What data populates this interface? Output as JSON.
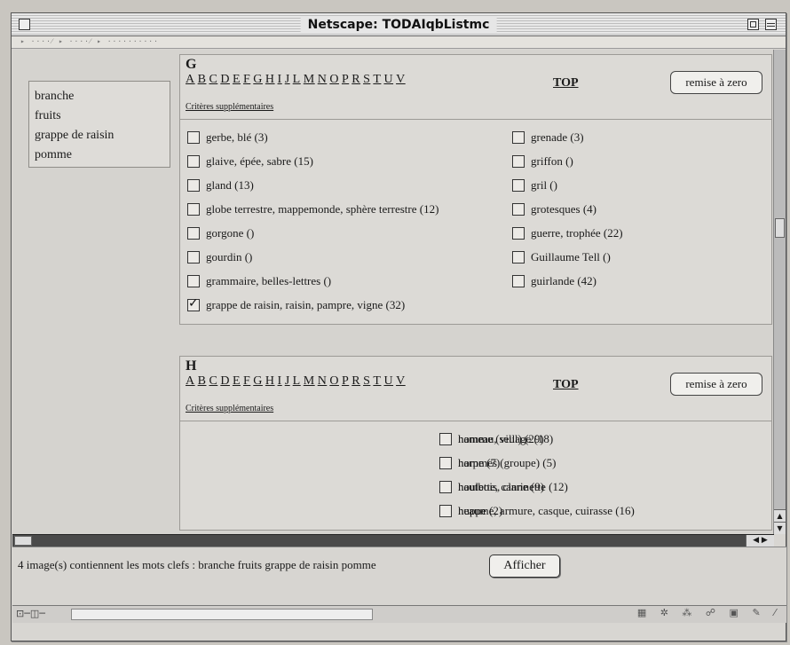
{
  "window": {
    "title": "Netscape: TODAIqbListmc"
  },
  "toolbar": {
    "tabs": "▸ ····⁄ ▸ ····⁄ ▸ ··········"
  },
  "keywords": [
    "branche",
    "fruits",
    "grappe de raisin",
    "pomme"
  ],
  "alphabet": [
    "A",
    "B",
    "C",
    "D",
    "E",
    "F",
    "G",
    "H",
    "I",
    "J",
    "L",
    "M",
    "N",
    "O",
    "P",
    "R",
    "S",
    "T",
    "U",
    "V"
  ],
  "sections": [
    {
      "letter": "G",
      "top_label": "TOP",
      "reset_label": "remise à zero",
      "criteria_label": "Critères supplémentaires",
      "left_items": [
        {
          "label": "gerbe, blé (3)",
          "checked": false
        },
        {
          "label": "glaive, épée, sabre (15)",
          "checked": false
        },
        {
          "label": "gland (13)",
          "checked": false
        },
        {
          "label": "globe terrestre, mappemonde, sphère terrestre (12)",
          "checked": false
        },
        {
          "label": "gorgone ()",
          "checked": false
        },
        {
          "label": "gourdin ()",
          "checked": false
        },
        {
          "label": "grammaire, belles-lettres ()",
          "checked": false
        },
        {
          "label": "grappe de raisin, raisin, pampre, vigne (32)",
          "checked": true
        }
      ],
      "right_items": [
        {
          "label": "grenade (3)",
          "checked": false
        },
        {
          "label": "griffon ()",
          "checked": false
        },
        {
          "label": "gril ()",
          "checked": false
        },
        {
          "label": "grotesques (4)",
          "checked": false
        },
        {
          "label": "guerre, trophée (22)",
          "checked": false
        },
        {
          "label": "Guillaume Tell ()",
          "checked": false
        },
        {
          "label": "guirlande (42)",
          "checked": false
        }
      ]
    },
    {
      "letter": "H",
      "top_label": "TOP",
      "reset_label": "remise à zero",
      "criteria_label": "Critères supplémentaires",
      "left_items": [
        {
          "label": "hameau, village (18)",
          "checked": false
        },
        {
          "label": "harpe (7)",
          "checked": false
        },
        {
          "label": "hautbois, clarinette (12)",
          "checked": false
        },
        {
          "label": "heaume, armure, casque, cuirasse (16)",
          "checked": false
        }
      ],
      "right_items": [
        {
          "label": "homme (seul) (29)",
          "checked": false
        },
        {
          "label": "hommes (groupe) (5)",
          "checked": false
        },
        {
          "label": "houlette, canne (9)",
          "checked": false
        },
        {
          "label": "huppe (2)",
          "checked": false
        }
      ]
    }
  ],
  "status": {
    "text": "4 image(s) contiennent les mots clefs : branche  fruits  grappe de raisin  pomme",
    "afficher_label": "Afficher"
  },
  "bottombar": {
    "left_glyphs": "⊡─◫─",
    "icons": "▦ ✲ ⁂ ☍ ▣ ✎ ⁄"
  }
}
